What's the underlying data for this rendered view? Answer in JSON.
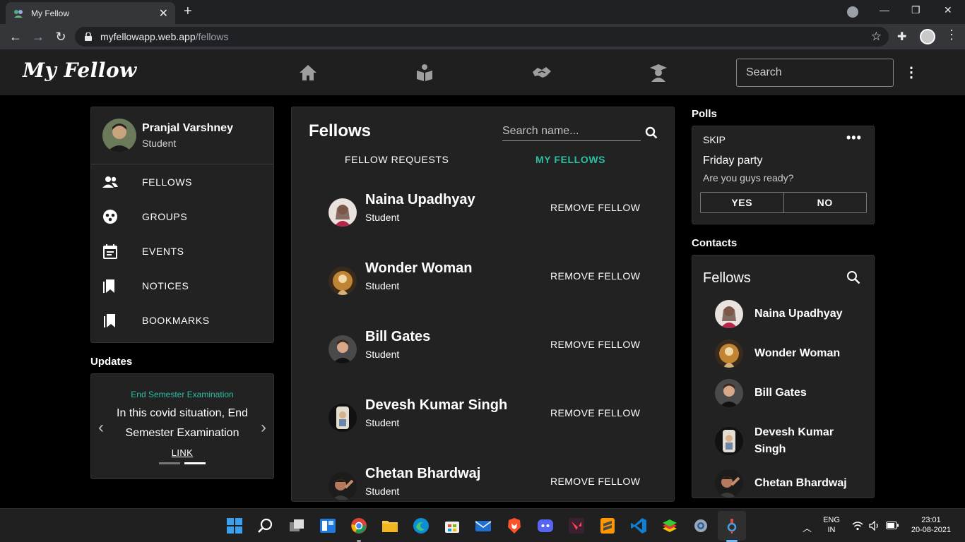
{
  "browser": {
    "tab_title": "My Fellow",
    "url_domain": "myfellowapp.web.app",
    "url_path": "/fellows"
  },
  "app": {
    "logo": "My Fellow",
    "nav_icons": [
      "home-icon",
      "book-icon",
      "handshake-icon",
      "graduate-icon"
    ],
    "search_placeholder": "Search",
    "accent_color": "#2bbfa3"
  },
  "sidebar": {
    "user_name": "Pranjal Varshney",
    "user_role": "Student",
    "items": [
      {
        "label": "FELLOWS",
        "icon": "people-icon"
      },
      {
        "label": "GROUPS",
        "icon": "groups-icon"
      },
      {
        "label": "EVENTS",
        "icon": "calendar-icon"
      },
      {
        "label": "NOTICES",
        "icon": "bookmark-icon"
      },
      {
        "label": "BOOKMARKS",
        "icon": "bookmarks-icon"
      }
    ]
  },
  "updates": {
    "title": "Updates",
    "headline": "End Semester Examination",
    "body": "In this covid situation, End Semester Examination",
    "link": "LINK"
  },
  "fellows": {
    "title": "Fellows",
    "search_placeholder": "Search name...",
    "tabs": [
      "FELLOW REQUESTS",
      "MY FELLOWS"
    ],
    "active_tab": "MY FELLOWS",
    "list": [
      {
        "name": "Naina Upadhyay",
        "role": "Student",
        "action": "REMOVE FELLOW"
      },
      {
        "name": "Wonder Woman",
        "role": "Student",
        "action": "REMOVE FELLOW"
      },
      {
        "name": "Bill Gates",
        "role": "Student",
        "action": "REMOVE FELLOW"
      },
      {
        "name": "Devesh Kumar Singh",
        "role": "Student",
        "action": "REMOVE FELLOW"
      },
      {
        "name": "Chetan Bhardwaj",
        "role": "Student",
        "action": "REMOVE FELLOW"
      }
    ]
  },
  "polls": {
    "title": "Polls",
    "skip": "SKIP",
    "question": "Friday party",
    "subtitle": "Are you guys ready?",
    "yes": "YES",
    "no": "NO"
  },
  "contacts": {
    "section_title": "Contacts",
    "card_title": "Fellows",
    "list": [
      "Naina Upadhyay",
      "Wonder Woman",
      "Bill Gates",
      "Devesh Kumar Singh",
      "Chetan Bhardwaj"
    ]
  },
  "taskbar": {
    "lang_top": "ENG",
    "lang_bottom": "IN",
    "time": "23:01",
    "date": "20-08-2021"
  }
}
